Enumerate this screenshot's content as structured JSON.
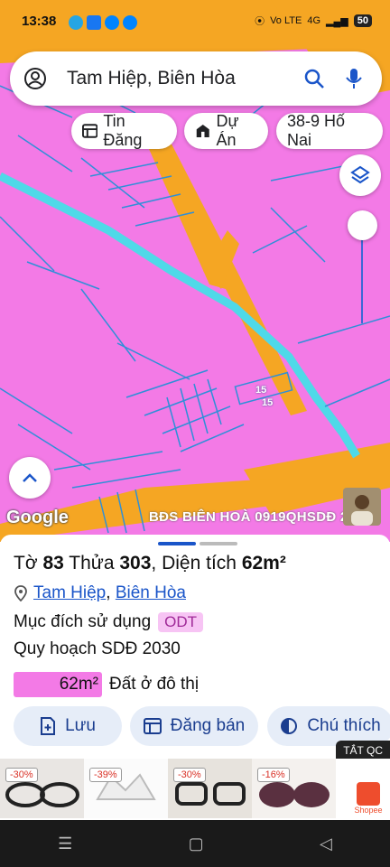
{
  "status_bar": {
    "time": "13:38",
    "network": "Vo LTE",
    "signal": "4G",
    "battery": "50"
  },
  "search": {
    "query": "Tam Hiệp, Biên Hòa"
  },
  "chips": [
    {
      "label": "Tin Đăng"
    },
    {
      "label": "Dự Án"
    },
    {
      "label": "38-9 Hố Nai"
    }
  ],
  "map": {
    "attribution": "Google",
    "watermark": "BĐS BIÊN HOÀ 0919QHSDĐ 2030",
    "plot_labels": [
      "15",
      "15"
    ],
    "land_color": "#f37ae6",
    "road_color": "#f5a623",
    "river_color": "#4fd9e8",
    "parcel_line_color": "#2f8fd8"
  },
  "parcel": {
    "to_label": "Tờ",
    "to": "83",
    "thua_label": "Thửa",
    "thua": "303",
    "area_label": ", Diện tích",
    "area": "62m²",
    "ward": "Tam Hiệp",
    "separator": ",",
    "city": "Biên Hòa",
    "purpose_label": "Mục đích sử dụng",
    "purpose_code": "ODT",
    "plan_label": "Quy hoạch SDĐ 2030",
    "zone_area": "62m²",
    "zone_name": "Đất ở đô thị"
  },
  "actions": [
    {
      "label": "Lưu"
    },
    {
      "label": "Đăng bán"
    },
    {
      "label": "Chú thích"
    }
  ],
  "ads": {
    "close_label": "TẮT QC",
    "items": [
      {
        "discount": "-30%"
      },
      {
        "discount": "-39%"
      },
      {
        "discount": "-30%"
      },
      {
        "discount": "-16%"
      }
    ],
    "shop_name": "Shopee"
  }
}
